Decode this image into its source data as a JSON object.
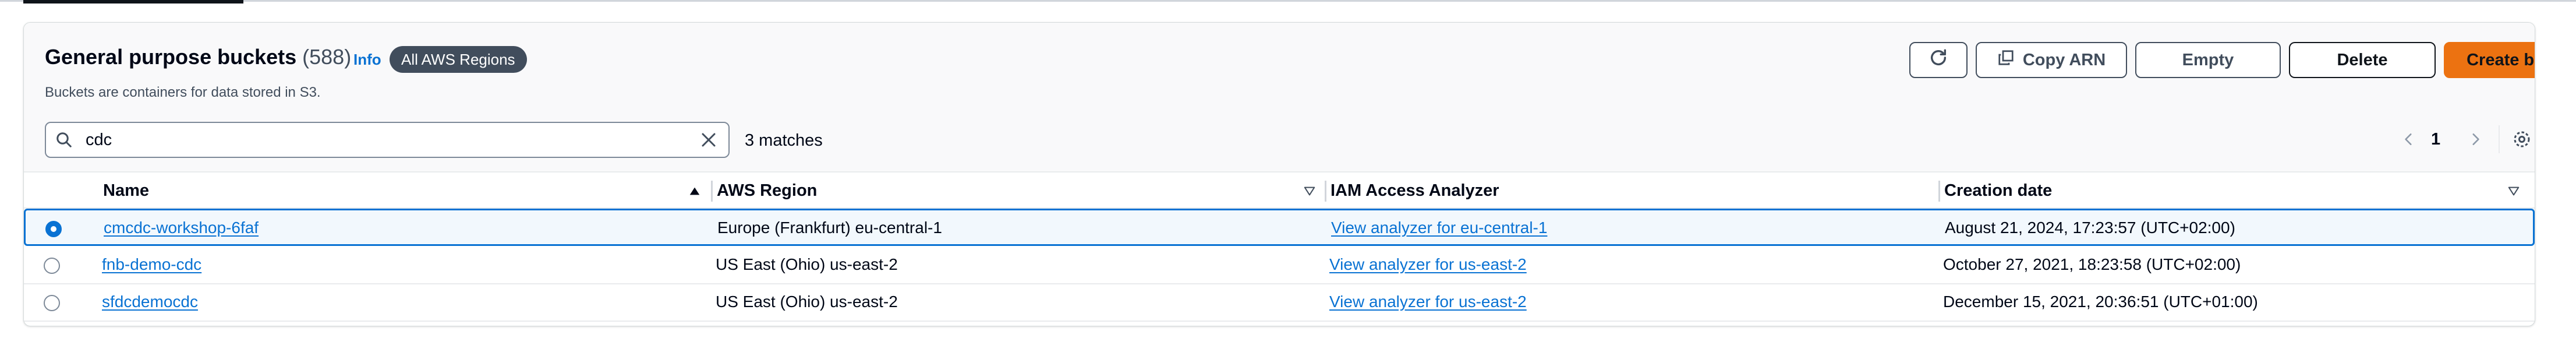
{
  "header": {
    "title": "General purpose buckets",
    "count": "(588)",
    "info_link": "Info",
    "region_badge": "All AWS Regions",
    "subtitle": "Buckets are containers for data stored in S3."
  },
  "toolbar": {
    "refresh_icon": "refresh-icon",
    "copy_arn_label": "Copy ARN",
    "empty_label": "Empty",
    "delete_label": "Delete",
    "create_label": "Create bucket",
    "create_color": "#ec7211"
  },
  "search": {
    "value": "cdc",
    "matches": "3 matches"
  },
  "pagination": {
    "current_page": "1"
  },
  "table": {
    "columns": {
      "name": "Name",
      "region": "AWS Region",
      "iam": "IAM Access Analyzer",
      "date": "Creation date"
    },
    "rows": [
      {
        "name": "cmcdc-workshop-6faf",
        "region": "Europe (Frankfurt) eu-central-1",
        "iam": "View analyzer for eu-central-1",
        "date": "August 21, 2024, 17:23:57 (UTC+02:00)",
        "selected": true
      },
      {
        "name": "fnb-demo-cdc",
        "region": "US East (Ohio) us-east-2",
        "iam": "View analyzer for us-east-2",
        "date": "October 27, 2021, 18:23:58 (UTC+02:00)",
        "selected": false
      },
      {
        "name": "sfdcdemocdc",
        "region": "US East (Ohio) us-east-2",
        "iam": "View analyzer for us-east-2",
        "date": "December 15, 2021, 20:36:51 (UTC+01:00)",
        "selected": false
      }
    ]
  },
  "colors": {
    "accent": "#0972d3",
    "primary_button": "#ec7211",
    "badge": "#414d5c"
  }
}
